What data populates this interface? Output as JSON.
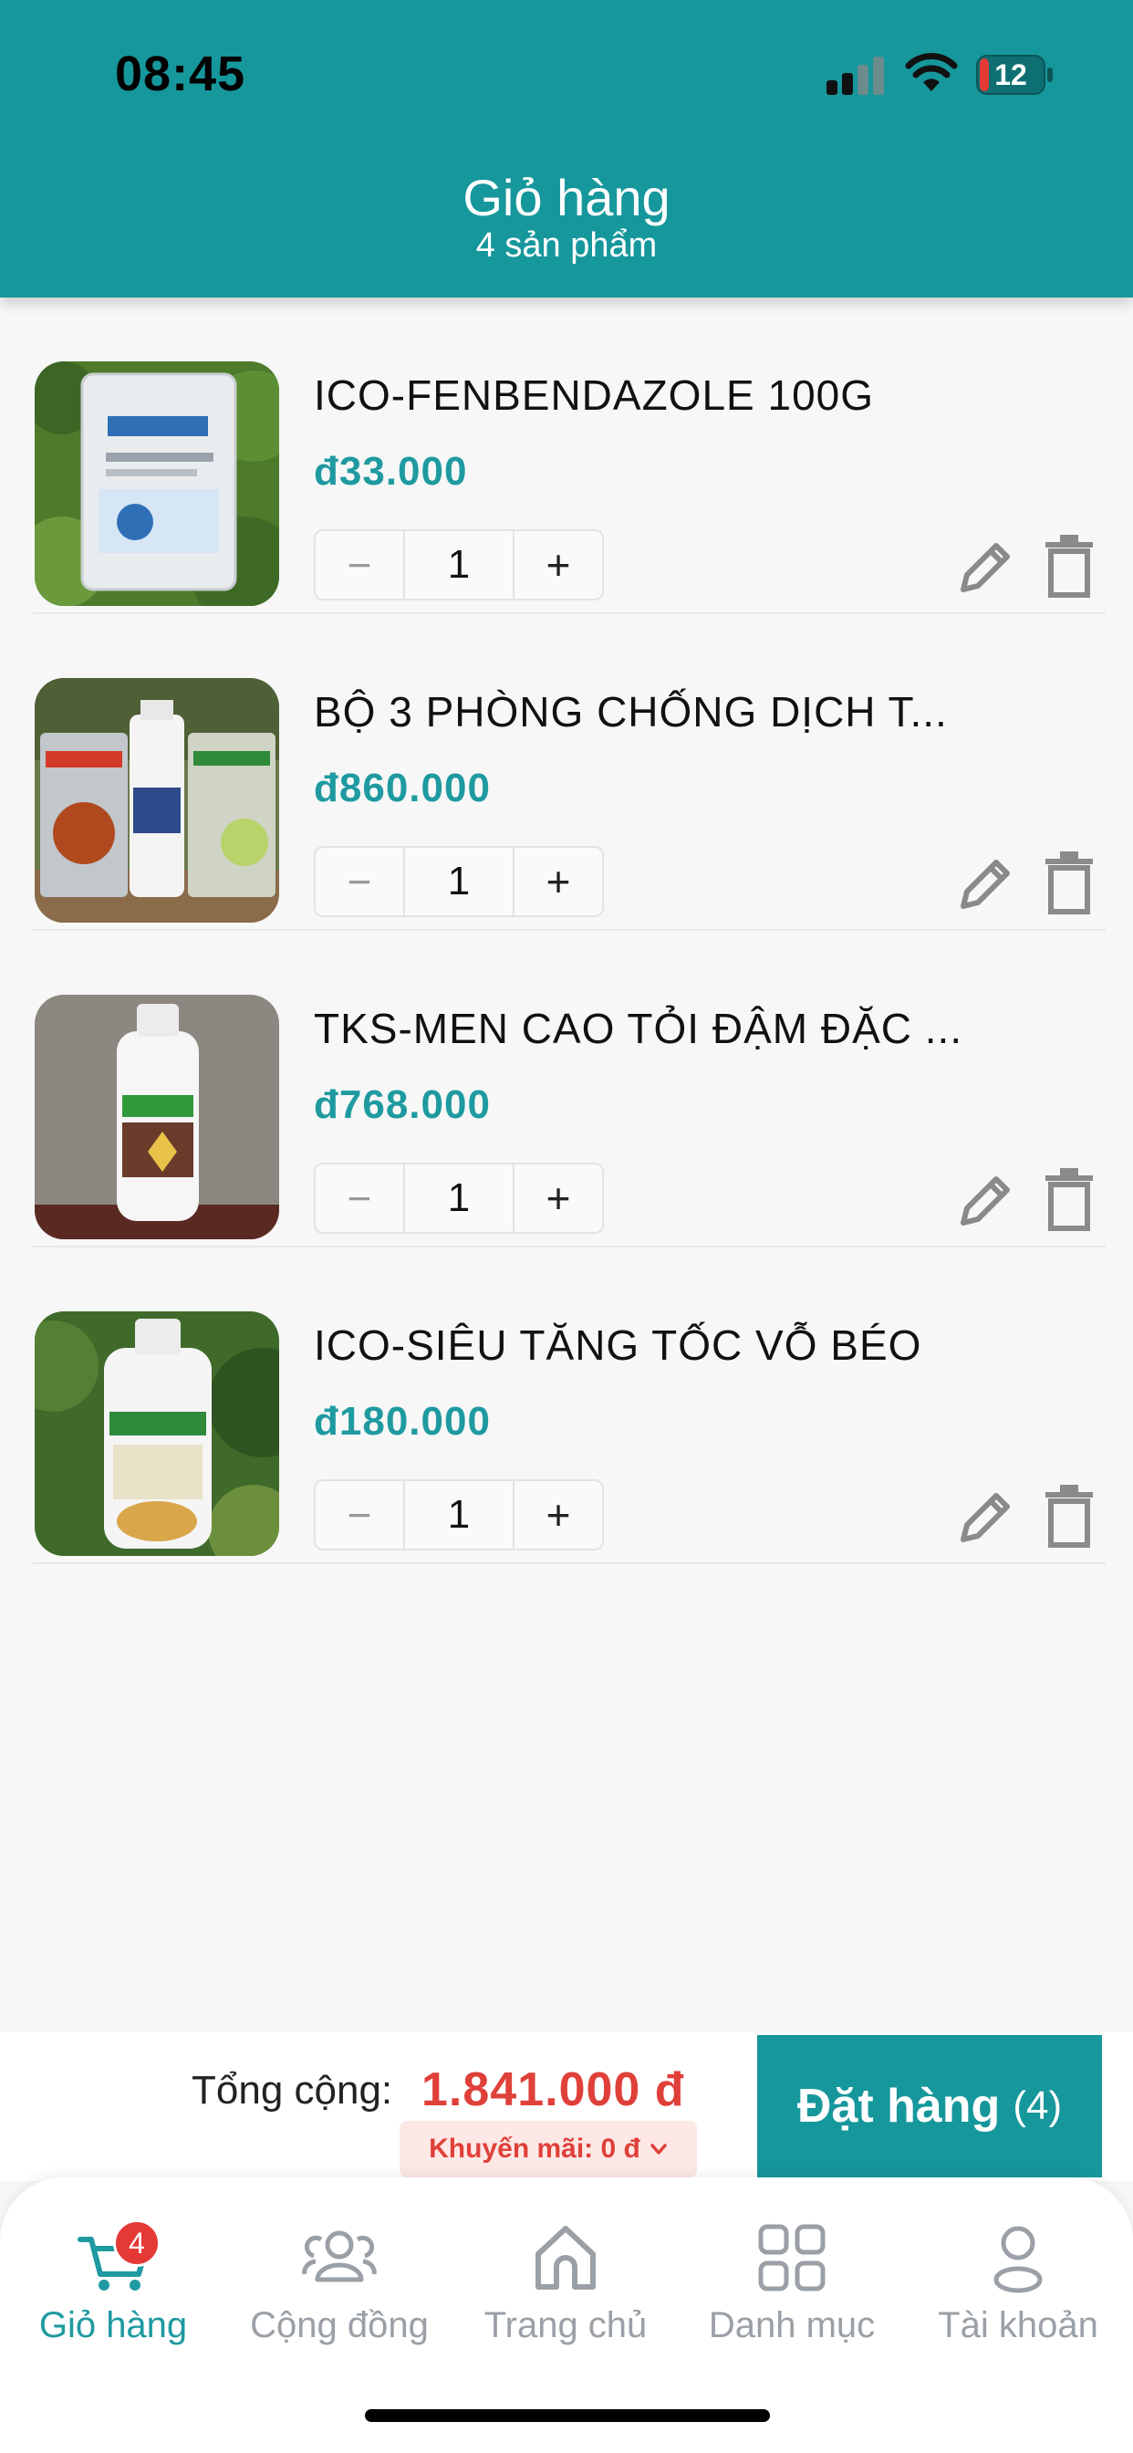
{
  "status_bar": {
    "time": "08:45",
    "battery": "12"
  },
  "header": {
    "title": "Giỏ hàng",
    "subtitle": "4 sản phẩm"
  },
  "cart": {
    "items": [
      {
        "name": "ICO-FENBENDAZOLE 100G",
        "price": "đ33.000",
        "qty": "1",
        "minus": "−",
        "plus": "+",
        "image": "fenbendazole-pouch"
      },
      {
        "name": "BỘ 3 PHÒNG CHỐNG DỊCH T...",
        "price": "đ860.000",
        "qty": "1",
        "minus": "−",
        "plus": "+",
        "image": "three-product-bundle"
      },
      {
        "name": "TKS-MEN CAO TỎI ĐẬM ĐẶC ...",
        "price": "đ768.000",
        "qty": "1",
        "minus": "−",
        "plus": "+",
        "image": "men-cao-toi-bottle"
      },
      {
        "name": "ICO-SIÊU TĂNG TỐC VỖ BÉO",
        "price": "đ180.000",
        "qty": "1",
        "minus": "−",
        "plus": "+",
        "image": "sieu-tang-toc-bottle"
      }
    ]
  },
  "summary": {
    "total_label": "Tổng cộng:",
    "total_value": "1.841.000 đ",
    "promo": "Khuyến mãi: 0 đ",
    "order_label": "Đặt hàng",
    "order_count": "(4)"
  },
  "tabbar": {
    "cart_badge": "4",
    "tabs": [
      {
        "label": "Giỏ hàng",
        "icon": "cart-icon",
        "active": true
      },
      {
        "label": "Cộng đồng",
        "icon": "community-icon",
        "active": false
      },
      {
        "label": "Trang chủ",
        "icon": "home-icon",
        "active": false
      },
      {
        "label": "Danh mục",
        "icon": "grid-icon",
        "active": false
      },
      {
        "label": "Tài khoản",
        "icon": "account-icon",
        "active": false
      }
    ]
  },
  "colors": {
    "primary": "#16979c",
    "price": "#1e9aa0",
    "total": "#e0403a",
    "badge": "#e53935"
  }
}
